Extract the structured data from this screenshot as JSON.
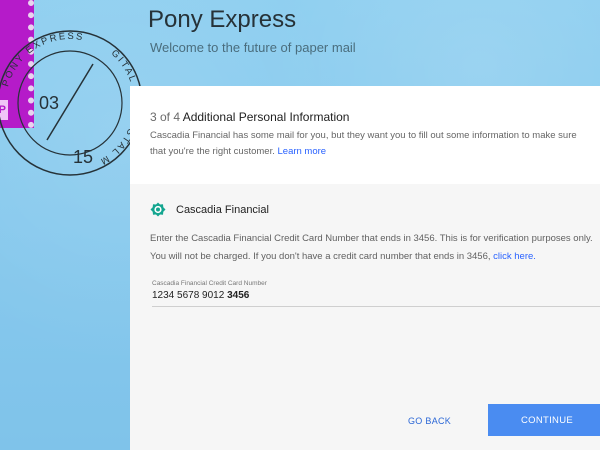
{
  "app": {
    "title": "Pony Express",
    "subtitle": "Welcome to the future of paper mail"
  },
  "postmark": {
    "top_text": "POSTAL M",
    "left_text": "GITAL",
    "bottom_text": "PONY EXPRESS",
    "day": "03",
    "year": "15",
    "stamp_label": "P"
  },
  "step": {
    "progress": "3 of 4",
    "title": "Additional Personal Information",
    "description": "Cascadia Financial has some mail for you, but they want you to fill out some information to make sure that you're the right customer.",
    "learn_more": "Learn more"
  },
  "sender": {
    "name": "Cascadia Financial",
    "instructions": "Enter the Cascadia Financial Credit Card Number that ends in 3456. This is for verification purposes only. You will not be charged. If you don't have a credit card number that ends in 3456,",
    "click_here": "click here."
  },
  "field": {
    "label": "Cascadia Financial Credit Card Number",
    "value_prefix": "1234 5678 9012",
    "value_last4": "3456"
  },
  "actions": {
    "go_back": "GO BACK",
    "continue": "CONTINUE"
  },
  "colors": {
    "background": "#83c7ec",
    "stamp": "#b51bc9",
    "primary": "#4a8cf1",
    "link": "#2962ff"
  }
}
